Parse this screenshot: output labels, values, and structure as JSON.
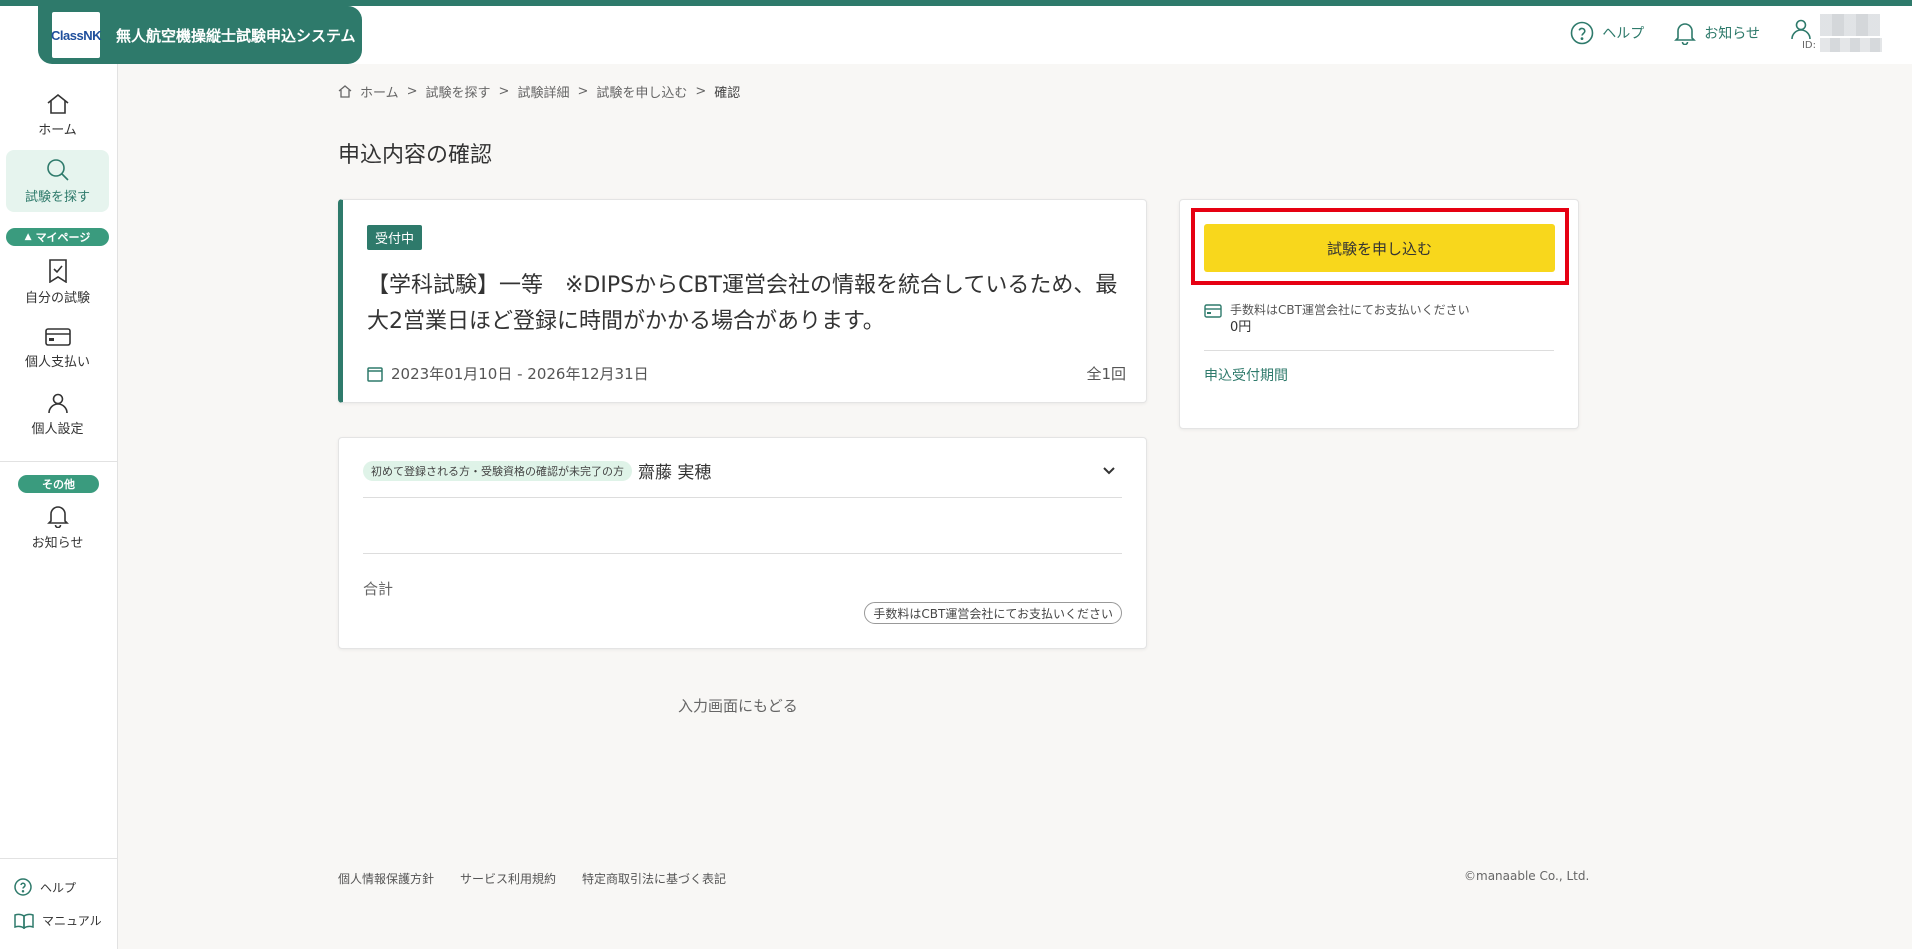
{
  "header": {
    "logo_text": "ClassNK",
    "app_title": "無人航空機操縦士試験申込システム",
    "help_label": "ヘルプ",
    "notice_label": "お知らせ",
    "id_label": "ID:"
  },
  "sidebar": {
    "items": [
      {
        "label": "ホーム",
        "icon": "home-icon"
      },
      {
        "label": "試験を探す",
        "icon": "search-icon"
      }
    ],
    "mypage_label": "マイページ",
    "mypage_items": [
      {
        "label": "自分の試験",
        "icon": "bookmark-check-icon"
      },
      {
        "label": "個人支払い",
        "icon": "credit-card-icon"
      },
      {
        "label": "個人設定",
        "icon": "person-icon"
      }
    ],
    "other_label": "その他",
    "other_items": [
      {
        "label": "お知らせ",
        "icon": "bell-icon"
      }
    ],
    "bottom_help": "ヘルプ",
    "bottom_manual": "マニュアル"
  },
  "breadcrumb": [
    "ホーム",
    "試験を探す",
    "試験詳細",
    "試験を申し込む",
    "確認"
  ],
  "page_title": "申込内容の確認",
  "exam": {
    "status": "受付中",
    "title": "【学科試験】一等　※DIPSからCBT運営会社の情報を統合しているため、最大2営業日ほど登録に時間がかかる場合があります。",
    "date_range": "2023年01月10日 - 2026年12月31日",
    "count": "全1回"
  },
  "applicant": {
    "tag": "初めて登録される方・受験資格の確認が未完了の方",
    "name": "齋藤 実穂",
    "total_label": "合計",
    "fee_note": "手数料はCBT運営会社にてお支払いください"
  },
  "back_link": "入力画面にもどる",
  "side_panel": {
    "apply_button": "試験を申し込む",
    "fee_note": "手数料はCBT運営会社にてお支払いください",
    "fee_amount": "0円",
    "period_label": "申込受付期間"
  },
  "footer": {
    "links": [
      "個人情報保護方針",
      "サービス利用規約",
      "特定商取引法に基づく表記"
    ],
    "copyright": "©manaable Co., Ltd."
  },
  "colors": {
    "brand": "#2e7a6b",
    "apply_button": "#f8d71c",
    "highlight": "#e60012",
    "active_bg": "#e6f4ee"
  }
}
